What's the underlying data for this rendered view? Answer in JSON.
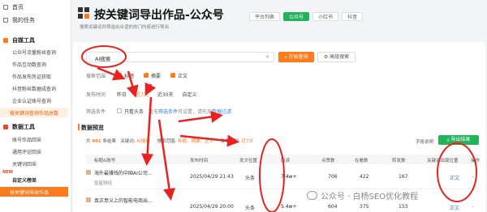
{
  "sidebar": {
    "top_items": [
      {
        "label": "首页"
      },
      {
        "label": "我的任务"
      }
    ],
    "sections": [
      {
        "label": "自媒工具",
        "items": [
          "公众号流量粉丝查询",
          "作品互动数查询",
          "作品发布凭证获取",
          "抖音粉丝数据成查询",
          "企业认证账号查询",
          "搜关键词查询作品总数"
        ]
      },
      {
        "label": "数据工具",
        "items": [
          "账号作品回采",
          "通用评论回采",
          "关键词回采"
        ]
      },
      {
        "label": "自定义榜单",
        "items": [
          "按关键词导出作品"
        ]
      }
    ],
    "new_badge": "NEW"
  },
  "header": {
    "title": "按关键词导出作品-公众号",
    "subtitle": "搜索关键词并筛选出合适的热门内容进行导出",
    "platform_tabs": [
      {
        "label": "平台列表",
        "active": false
      },
      {
        "label": "公众号",
        "active": true
      },
      {
        "label": "小红书",
        "active": false
      },
      {
        "label": "抖音",
        "active": false
      }
    ]
  },
  "search": {
    "value": "AI搜索",
    "clear_icon": "✕",
    "start_label": "开始查询",
    "advanced_label": "高级搜索"
  },
  "filters": {
    "scope_label": "搜索范围",
    "scope_options": [
      "标题",
      "摘要",
      "正文"
    ],
    "time_label": "发布时间",
    "time_options": [
      "昨日",
      "近7天",
      "近30天",
      "自定义"
    ],
    "time_active": "近7天",
    "cond_label": "筛选条件",
    "cond_check": "只看头条",
    "cond_hint_prefix": "暂无",
    "cond_hint_link1": "筛选条件",
    "cond_hint_mid": "可设置，请先加",
    "cond_hint_link2": "数据过滤"
  },
  "preview": {
    "title": "数据预览",
    "summary_prefix": "共",
    "summary_count": "901",
    "summary_unit": "条结果",
    "kw_label": "关键词:",
    "kw_value": "AI搜索",
    "range_label": "搜索范围:",
    "range_value": "标题、摘要、正文",
    "time_label": "发布时间:",
    "time_value": "近7天",
    "table_field": "字段说明",
    "export_label": "导出结果"
  },
  "table": {
    "headers": [
      "标题&账号",
      "发布时间",
      "发文位置",
      "阅读",
      "点赞数",
      "在看数",
      "转发数",
      "关键词出现位置",
      "操作"
    ],
    "rows": [
      {
        "title": "海外最赚钱的中国AI公司...",
        "account": "氪星财经",
        "time": "2025/04/29 21:43",
        "type": "头条",
        "read": "7.4w+",
        "like": "706",
        "watch": "422",
        "share": "167",
        "kw": "正文",
        "link": "-"
      },
      {
        "title": "真正意义上的智能电商出...",
        "account": "",
        "time": "2025/04/29 20:00",
        "type": "头条",
        "read": "5.4w+",
        "like": "604",
        "watch": "375",
        "share": "153",
        "kw": "正文",
        "link": "-"
      }
    ]
  },
  "watermark": {
    "text": "公众号 · 白杨SEO优化教程"
  },
  "colors": {
    "accent": "#ff7a1a",
    "green": "#22b35a",
    "annotation": "#e8231f"
  }
}
